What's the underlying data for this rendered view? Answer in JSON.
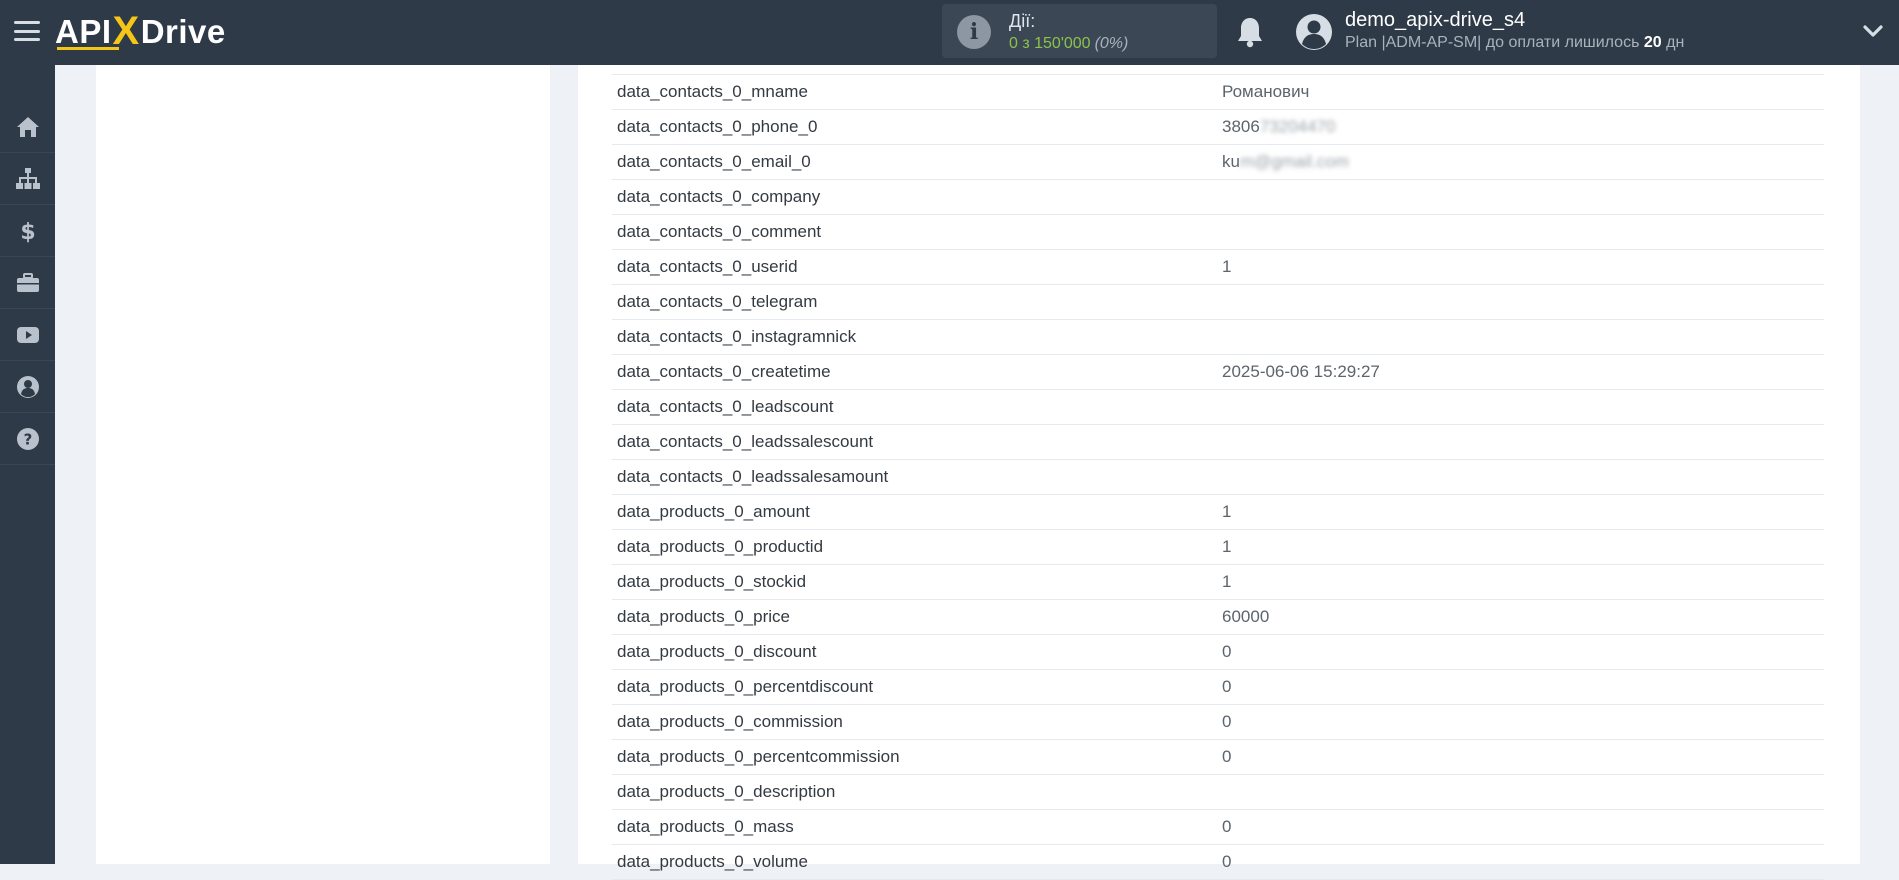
{
  "header": {
    "logo": {
      "left": "API",
      "x": "X",
      "right": "Drive"
    },
    "actions": {
      "label": "Дії:",
      "value": "0 з 150'000",
      "percent": "(0%)"
    },
    "user": {
      "name": "demo_apix-drive_s4",
      "plan_prefix": "Plan |ADM-AP-SM| до оплати лишилось",
      "days": "20",
      "days_suffix": "дн"
    },
    "icons": {
      "menu": "menu-icon",
      "info": "info-icon",
      "bell": "bell-icon",
      "avatar": "user-avatar-icon",
      "chevron": "chevron-down-icon"
    },
    "info_glyph": "i"
  },
  "sidebar": {
    "items": [
      {
        "icon": "home-icon"
      },
      {
        "icon": "sitemap-icon"
      },
      {
        "icon": "dollar-icon"
      },
      {
        "icon": "briefcase-icon"
      },
      {
        "icon": "youtube-icon"
      },
      {
        "icon": "user-circle-icon"
      },
      {
        "icon": "help-icon"
      }
    ]
  },
  "fields": {
    "rows": [
      {
        "key": "data_contacts_0_mname",
        "value": "Романович"
      },
      {
        "key": "data_contacts_0_phone_0",
        "value": "3806",
        "value_blurred": "73204470"
      },
      {
        "key": "data_contacts_0_email_0",
        "value": "ku",
        "value_blurred": "m@gmail.com"
      },
      {
        "key": "data_contacts_0_company",
        "value": ""
      },
      {
        "key": "data_contacts_0_comment",
        "value": ""
      },
      {
        "key": "data_contacts_0_userid",
        "value": "1"
      },
      {
        "key": "data_contacts_0_telegram",
        "value": ""
      },
      {
        "key": "data_contacts_0_instagramnick",
        "value": ""
      },
      {
        "key": "data_contacts_0_createtime",
        "value": "2025-06-06 15:29:27"
      },
      {
        "key": "data_contacts_0_leadscount",
        "value": ""
      },
      {
        "key": "data_contacts_0_leadssalescount",
        "value": ""
      },
      {
        "key": "data_contacts_0_leadssalesamount",
        "value": ""
      },
      {
        "key": "data_products_0_amount",
        "value": "1"
      },
      {
        "key": "data_products_0_productid",
        "value": "1"
      },
      {
        "key": "data_products_0_stockid",
        "value": "1"
      },
      {
        "key": "data_products_0_price",
        "value": "60000"
      },
      {
        "key": "data_products_0_discount",
        "value": "0"
      },
      {
        "key": "data_products_0_percentdiscount",
        "value": "0"
      },
      {
        "key": "data_products_0_commission",
        "value": "0"
      },
      {
        "key": "data_products_0_percentcommission",
        "value": "0"
      },
      {
        "key": "data_products_0_description",
        "value": ""
      },
      {
        "key": "data_products_0_mass",
        "value": "0"
      },
      {
        "key": "data_products_0_volume",
        "value": "0"
      }
    ]
  },
  "colors": {
    "header_bg": "#2e3a47",
    "accent_yellow": "#f5c518",
    "actions_green": "#8bc34a",
    "page_bg": "#eef1f5"
  }
}
